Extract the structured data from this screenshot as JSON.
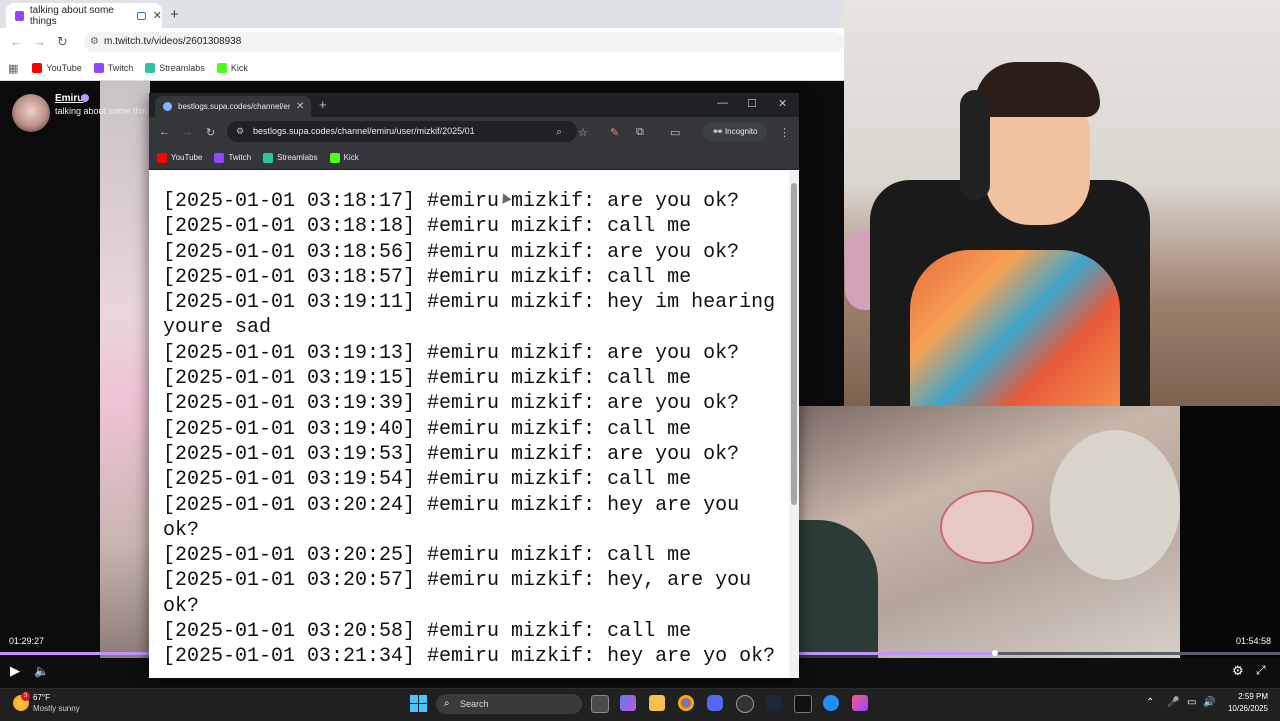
{
  "outer_browser": {
    "tab_title": "talking about some things",
    "url": "m.twitch.tv/videos/2601308938",
    "bookmarks": [
      "YouTube",
      "Twitch",
      "Streamlabs",
      "Kick"
    ]
  },
  "stream": {
    "streamer_name": "Emiru",
    "title": "talking about some thin",
    "time_current": "01:29:27",
    "time_total": "01:54:58",
    "progress": 0.777
  },
  "inner_browser": {
    "tab_title": "bestlogs.supa.codes/channel/emiru/user/mizkif/2025/01",
    "url": "bestlogs.supa.codes/channel/emiru/user/mizkif/2025/01",
    "incognito_label": "Incognito",
    "bookmarks": [
      "YouTube",
      "Twitch",
      "Streamlabs",
      "Kick"
    ]
  },
  "log_lines": [
    "[2025-01-01 03:18:17] #emiru mizkif: are you ok?",
    "[2025-01-01 03:18:18] #emiru mizkif: call me",
    "[2025-01-01 03:18:56] #emiru mizkif: are you ok?",
    "[2025-01-01 03:18:57] #emiru mizkif: call me",
    "[2025-01-01 03:19:11] #emiru mizkif: hey im hearing youre sad",
    "[2025-01-01 03:19:13] #emiru mizkif: are you ok?",
    "[2025-01-01 03:19:15] #emiru mizkif: call me",
    "[2025-01-01 03:19:39] #emiru mizkif: are you ok?",
    "[2025-01-01 03:19:40] #emiru mizkif: call me",
    "[2025-01-01 03:19:53] #emiru mizkif: are you ok?",
    "[2025-01-01 03:19:54] #emiru mizkif: call me",
    "[2025-01-01 03:20:24] #emiru mizkif: hey are you ok?",
    "[2025-01-01 03:20:25] #emiru mizkif: call me",
    "[2025-01-01 03:20:57] #emiru mizkif: hey, are you ok?",
    "[2025-01-01 03:20:58] #emiru mizkif: call me",
    "[2025-01-01 03:21:34] #emiru mizkif: hey are yo ok?"
  ],
  "taskbar": {
    "weather_temp": "67°F",
    "weather_desc": "Mostly sunny",
    "weather_badge": "3",
    "search_placeholder": "Search",
    "time": "2:59 PM",
    "date": "10/26/2025"
  },
  "colors": {
    "twitch": "#9146ff",
    "progress": "#bf94ff",
    "youtube": "#ff0000",
    "kick": "#53fc18",
    "streamlabs": "#31c3a2"
  }
}
